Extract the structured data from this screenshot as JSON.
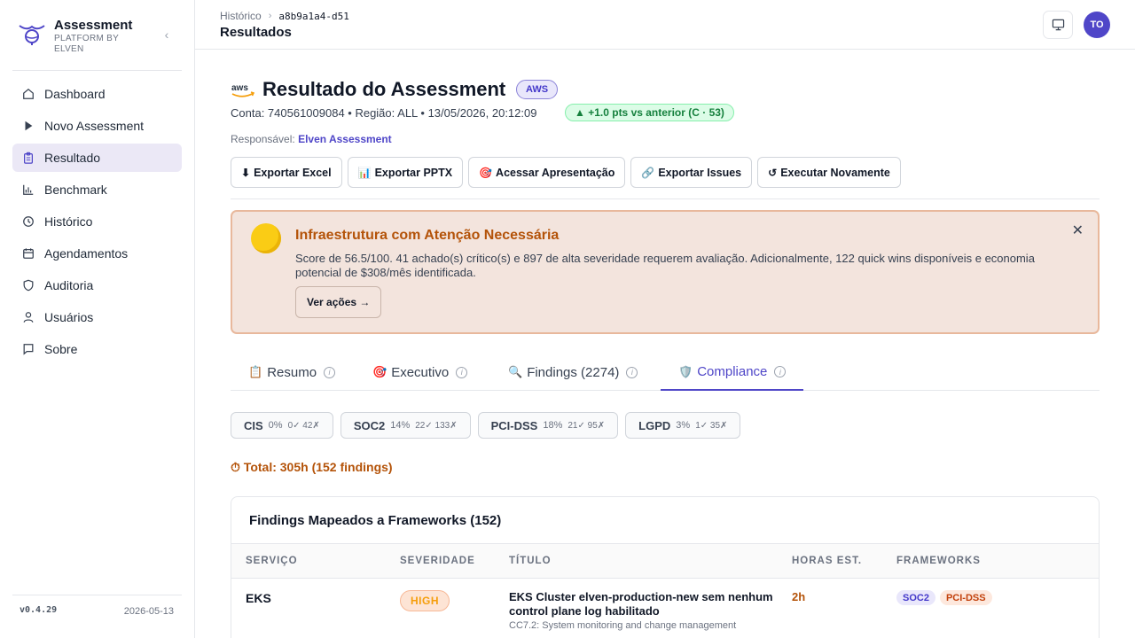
{
  "sidebar": {
    "brand_title": "Assessment",
    "brand_sub": "PLATFORM BY ELVEN",
    "items": [
      {
        "label": "Dashboard",
        "icon": "home-icon"
      },
      {
        "label": "Novo Assessment",
        "icon": "play-icon"
      },
      {
        "label": "Resultado",
        "icon": "clipboard-icon",
        "active": true
      },
      {
        "label": "Benchmark",
        "icon": "bar-chart-icon"
      },
      {
        "label": "Histórico",
        "icon": "clock-icon"
      },
      {
        "label": "Agendamentos",
        "icon": "calendar-icon"
      },
      {
        "label": "Auditoria",
        "icon": "shield-icon"
      },
      {
        "label": "Usuários",
        "icon": "user-icon"
      },
      {
        "label": "Sobre",
        "icon": "message-icon"
      }
    ],
    "version": "v0.4.29",
    "date": "2026-05-13"
  },
  "header": {
    "breadcrumb_parent": "Histórico",
    "breadcrumb_id": "a8b9a1a4-d51",
    "page_title": "Resultados",
    "avatar_initials": "TO"
  },
  "result": {
    "title": "Resultado do Assessment",
    "provider_badge": "AWS",
    "provider_logo_text": "aws",
    "meta": "Conta: 740561009084 • Região: ALL • 13/05/2026, 20:12:09",
    "delta": "▲ +1.0 pts vs anterior (C · 53)",
    "responsible_label": "Responsável:",
    "responsible_name": "Elven Assessment"
  },
  "actions": [
    {
      "icon": "⬇",
      "label": "Exportar Excel"
    },
    {
      "icon": "📊",
      "label": "Exportar PPTX"
    },
    {
      "icon": "🎯",
      "label": "Acessar Apresentação"
    },
    {
      "icon": "🔗",
      "label": "Exportar Issues"
    },
    {
      "icon": "↺",
      "label": "Executar Novamente"
    }
  ],
  "alert": {
    "title": "Infraestrutura com Atenção Necessária",
    "text": "Score de 56.5/100. 41 achado(s) crítico(s) e 897 de alta severidade requerem avaliação. Adicionalmente, 122 quick wins disponíveis e economia potencial de $308/mês identificada.",
    "button": "Ver ações →",
    "close": "✕"
  },
  "tabs": [
    {
      "emoji": "📋",
      "label": "Resumo"
    },
    {
      "emoji": "🎯",
      "label": "Executivo"
    },
    {
      "emoji": "🔍",
      "label": "Findings (2274)"
    },
    {
      "emoji": "🛡️",
      "label": "Compliance",
      "active": true
    }
  ],
  "frameworks": [
    {
      "name": "CIS",
      "pct": "0%",
      "counts": "0✓ 42✗"
    },
    {
      "name": "SOC2",
      "pct": "14%",
      "counts": "22✓ 133✗"
    },
    {
      "name": "PCI-DSS",
      "pct": "18%",
      "counts": "21✓ 95✗"
    },
    {
      "name": "LGPD",
      "pct": "3%",
      "counts": "1✓ 35✗"
    }
  ],
  "total": "⏱ Total: 305h (152 findings)",
  "table": {
    "title": "Findings Mapeados a Frameworks (152)",
    "headers": [
      "SERVIÇO",
      "SEVERIDADE",
      "TÍTULO",
      "HORAS EST.",
      "FRAMEWORKS"
    ],
    "rows": [
      {
        "service": "EKS",
        "severity": "HIGH",
        "title": "EKS Cluster elven-production-new sem nenhum control plane log habilitado",
        "subtitle": "CC7.2: System monitoring and change management",
        "hours": "2h",
        "frameworks": [
          "SOC2",
          "PCI-DSS"
        ]
      }
    ]
  },
  "colors": {
    "accent": "#4f46c8",
    "warning": "#b45309",
    "alert_bg": "#f3e4dd",
    "success": "#15803d"
  }
}
